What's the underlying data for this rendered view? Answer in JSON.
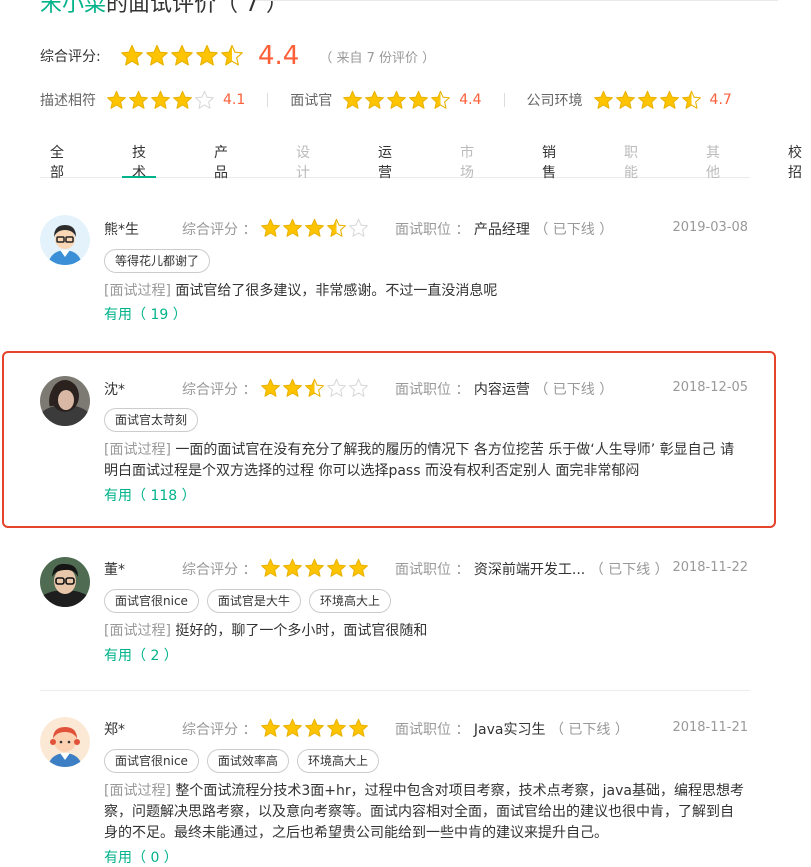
{
  "header": {
    "company_name": "宋小菜",
    "title_suffix": "的面试评价（ 7 ）"
  },
  "overall": {
    "label": "综合评分:",
    "stars": 4.5,
    "score": "4.4",
    "count_text": "（ 来自 7 份评价 ）"
  },
  "sub_ratings": [
    {
      "label": "描述相符",
      "stars": 4,
      "value": "4.1"
    },
    {
      "label": "面试官",
      "stars": 4.5,
      "value": "4.4"
    },
    {
      "label": "公司环境",
      "stars": 4.5,
      "value": "4.7"
    }
  ],
  "tabs": [
    {
      "label": "全部",
      "state": "normal"
    },
    {
      "label": "技术",
      "state": "active"
    },
    {
      "label": "产品",
      "state": "normal"
    },
    {
      "label": "设计",
      "state": "disabled"
    },
    {
      "label": "运营",
      "state": "normal"
    },
    {
      "label": "市场",
      "state": "disabled"
    },
    {
      "label": "销售",
      "state": "normal"
    },
    {
      "label": "职能",
      "state": "disabled"
    },
    {
      "label": "其他",
      "state": "disabled"
    },
    {
      "label": "校招",
      "state": "normal"
    }
  ],
  "labels": {
    "rating_label": "综合评分 ：",
    "position_label": "面试职位 ：",
    "process_prefix": "[面试过程]"
  },
  "reviews": [
    {
      "name": "熊*生",
      "stars": 3.5,
      "position": "产品经理",
      "status": "（ 已下线 ）",
      "date": "2019-03-08",
      "tags": [
        "等得花儿都谢了"
      ],
      "content": "面试官给了很多建议，非常感谢。不过一直没消息呢",
      "useful": "有用（ 19 ）"
    },
    {
      "name": "沈*",
      "stars": 2.5,
      "position": "内容运营",
      "status": "（ 已下线 ）",
      "date": "2018-12-05",
      "tags": [
        "面试官太苛刻"
      ],
      "content": "一面的面试官在没有充分了解我的履历的情况下 各方位挖苦 乐于做‘人生导师’ 彰显自己 请明白面试过程是个双方选择的过程 你可以选择pass 而没有权利否定别人 面完非常郁闷",
      "useful": "有用（ 118 ）"
    },
    {
      "name": "董*",
      "stars": 5,
      "position": "资深前端开发工...",
      "status": "（ 已下线 ）",
      "date": "2018-11-22",
      "tags": [
        "面试官很nice",
        "面试官是大牛",
        "环境高大上"
      ],
      "content": "挺好的，聊了一个多小时，面试官很随和",
      "useful": "有用（ 2 ）"
    },
    {
      "name": "郑*",
      "stars": 5,
      "position": "Java实习生",
      "status": "（ 已下线 ）",
      "date": "2018-11-21",
      "tags": [
        "面试官很nice",
        "面试效率高",
        "环境高大上"
      ],
      "content": "整个面试流程分技术3面+hr，过程中包含对项目考察，技术点考察，java基础，编程思想考察，问题解决思路考察，以及意向考察等。面试内容相对全面，面试官给出的建议也很中肯，了解到自身的不足。最终未能通过，之后也希望贵公司能给到一些中肯的建议来提升自己。",
      "useful": "有用（ 0 ）"
    }
  ],
  "colors": {
    "accent": "#00b38a",
    "score": "#fd5f39",
    "star_fill": "#fec400",
    "star_empty": "#d8d8d8",
    "highlight": "#e5432b"
  }
}
